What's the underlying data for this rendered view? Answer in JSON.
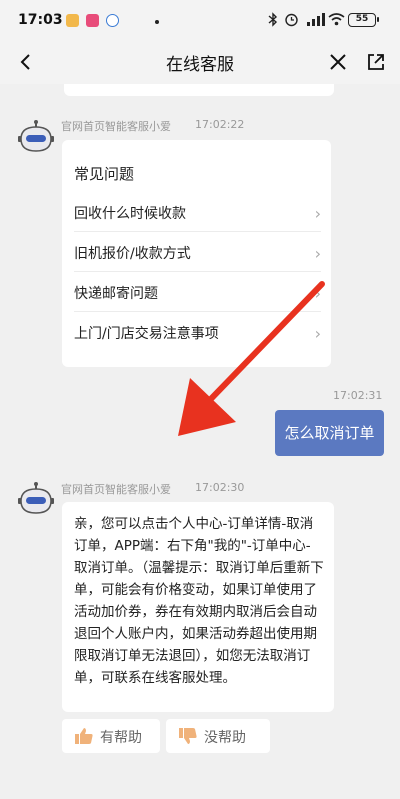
{
  "status_bar": {
    "time": "17:03",
    "battery": "55",
    "colors": {
      "app1": "#f2b84b",
      "app2": "#e84c7a",
      "app3": "#3a7bd5"
    },
    "icons": [
      "bluetooth-icon",
      "alarm-icon",
      "signal-icon",
      "wifi-icon",
      "battery-icon"
    ]
  },
  "nav": {
    "title": "在线客服",
    "back_icon": "chevron-left-icon",
    "close_icon": "close-icon",
    "share_icon": "share-icon"
  },
  "messages": [
    {
      "sender": "官网首页智能客服小爱",
      "time": "17:02:22",
      "faq": {
        "title": "常见问题",
        "items": [
          "回收什么时候收款",
          "旧机报价/收款方式",
          "快递邮寄问题",
          "上门/门店交易注意事项"
        ]
      }
    },
    {
      "time": "17:02:31",
      "text": "怎么取消订单"
    },
    {
      "sender": "官网首页智能客服小爱",
      "time": "17:02:30",
      "text": "亲，您可以点击个人中心-订单详情-取消订单，APP端：右下角\"我的\"-订单中心-取消订单。（温馨提示：取消订单后重新下单，可能会有价格变动，如果订单使用了活动加价券，券在有效期内取消后会自动退回个人账户内，如果活动券超出使用期限取消订单无法退回），如您无法取消订单，可联系在线客服处理。",
      "feedback": {
        "helpful": "有帮助",
        "not_helpful": "没帮助"
      }
    }
  ],
  "colors": {
    "user_bubble": "#5b79c1",
    "arrow": "#e8321f",
    "thumb": "#f0b27a"
  }
}
